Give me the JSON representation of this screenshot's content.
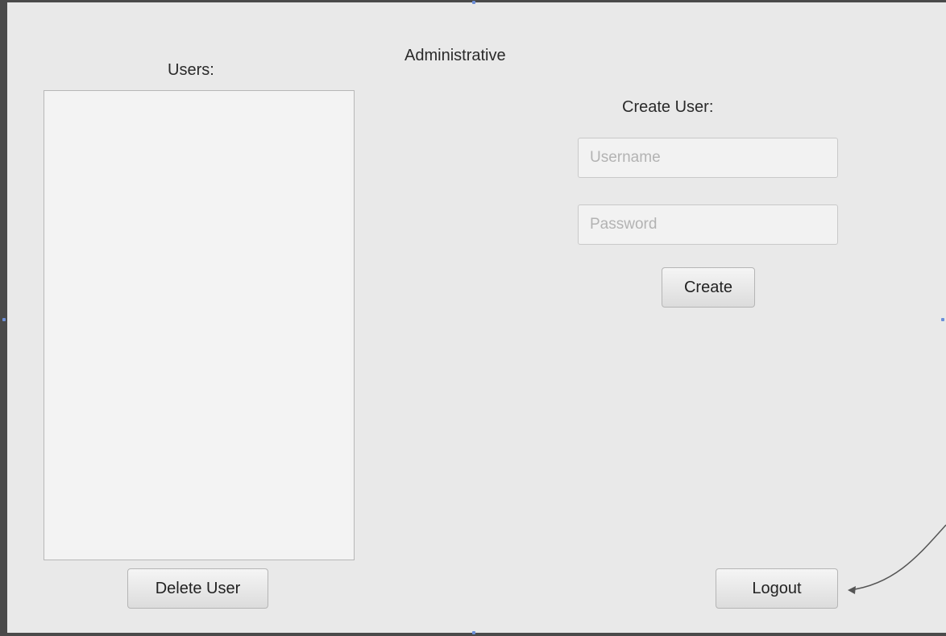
{
  "window": {
    "title": "Administrative"
  },
  "users_panel": {
    "label": "Users:",
    "items": [],
    "delete_label": "Delete User"
  },
  "create_panel": {
    "label": "Create User:",
    "username_placeholder": "Username",
    "password_placeholder": "Password",
    "create_label": "Create"
  },
  "logout_label": "Logout",
  "colors": {
    "background": "#e9e9e9",
    "list_background": "#f3f3f3",
    "border": "#4a4a4a",
    "annotation_arrow": "#555555"
  }
}
